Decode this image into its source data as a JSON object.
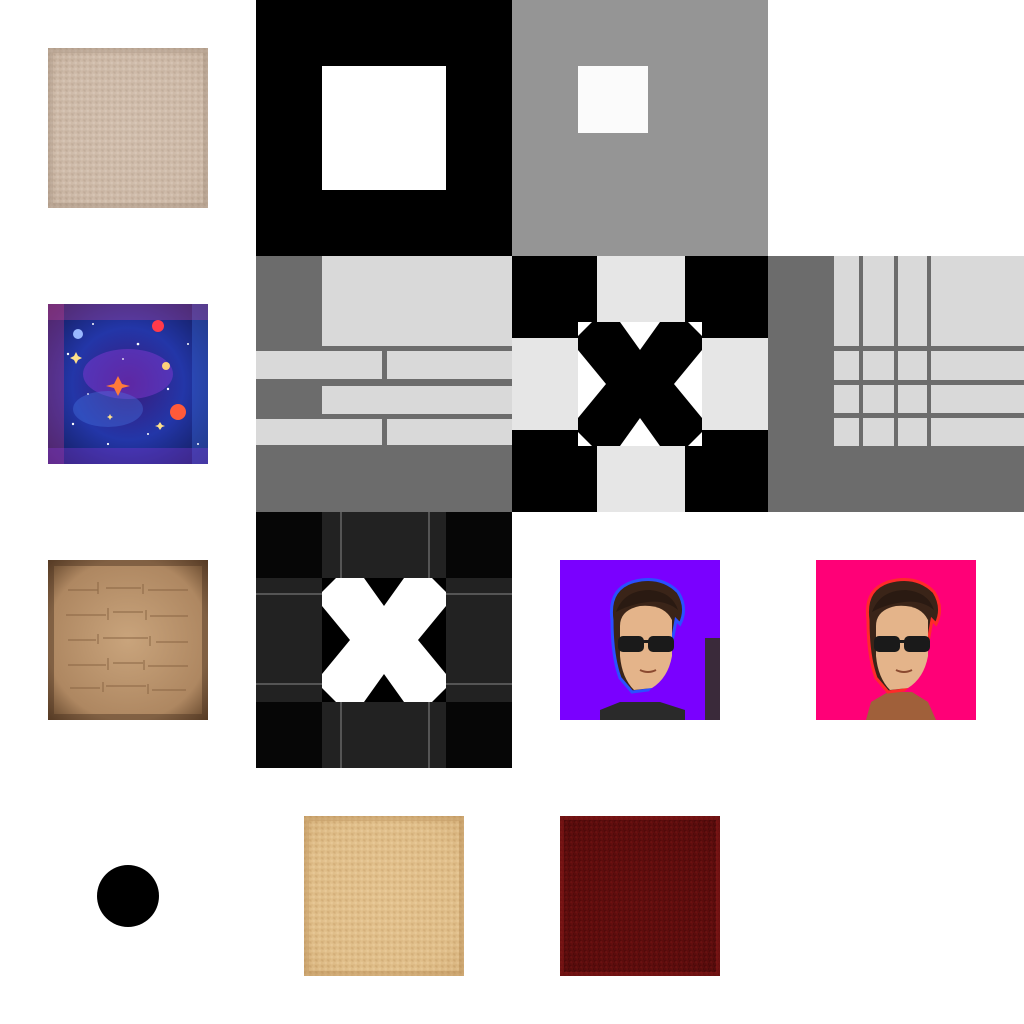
{
  "atlas": {
    "colors": {
      "background": "#ffffff",
      "sand_light": "#d4c2b2",
      "space_blue": "#1f2e8a",
      "space_purple": "#5a2ea8",
      "stone_brown": "#a5805c",
      "dot_black": "#000000",
      "sand_yellow": "#e3c28f",
      "blood_red": "#6a1010",
      "gray_mid": "#959595",
      "gray_dark": "#6c6c6c",
      "gray_light": "#d9d9d9",
      "portrait_bg_violet": "#7a00ff",
      "portrait_bg_pink": "#ff0077"
    },
    "items": [
      {
        "name": "sand-texture",
        "icon": "sand-texture-icon"
      },
      {
        "name": "frame-black-white",
        "icon": "square-frame-icon"
      },
      {
        "name": "frame-gray-white",
        "icon": "square-frame-icon"
      },
      {
        "name": "space-nebula-texture",
        "icon": "nebula-texture-icon"
      },
      {
        "name": "gray-brick-panel-left",
        "icon": "panel-icon"
      },
      {
        "name": "x-cross-panel",
        "icon": "x-icon"
      },
      {
        "name": "grid-panel-right",
        "icon": "grid-icon"
      },
      {
        "name": "stone-wall-texture",
        "icon": "stone-texture-icon"
      },
      {
        "name": "dark-x-panel",
        "icon": "x-icon"
      },
      {
        "name": "portrait-violet",
        "icon": "portrait-icon"
      },
      {
        "name": "portrait-pink",
        "icon": "portrait-icon"
      },
      {
        "name": "black-dot",
        "icon": "circle-icon"
      },
      {
        "name": "sand-yellow-texture",
        "icon": "sand-texture-icon"
      },
      {
        "name": "red-noise-texture",
        "icon": "red-texture-icon"
      }
    ]
  }
}
